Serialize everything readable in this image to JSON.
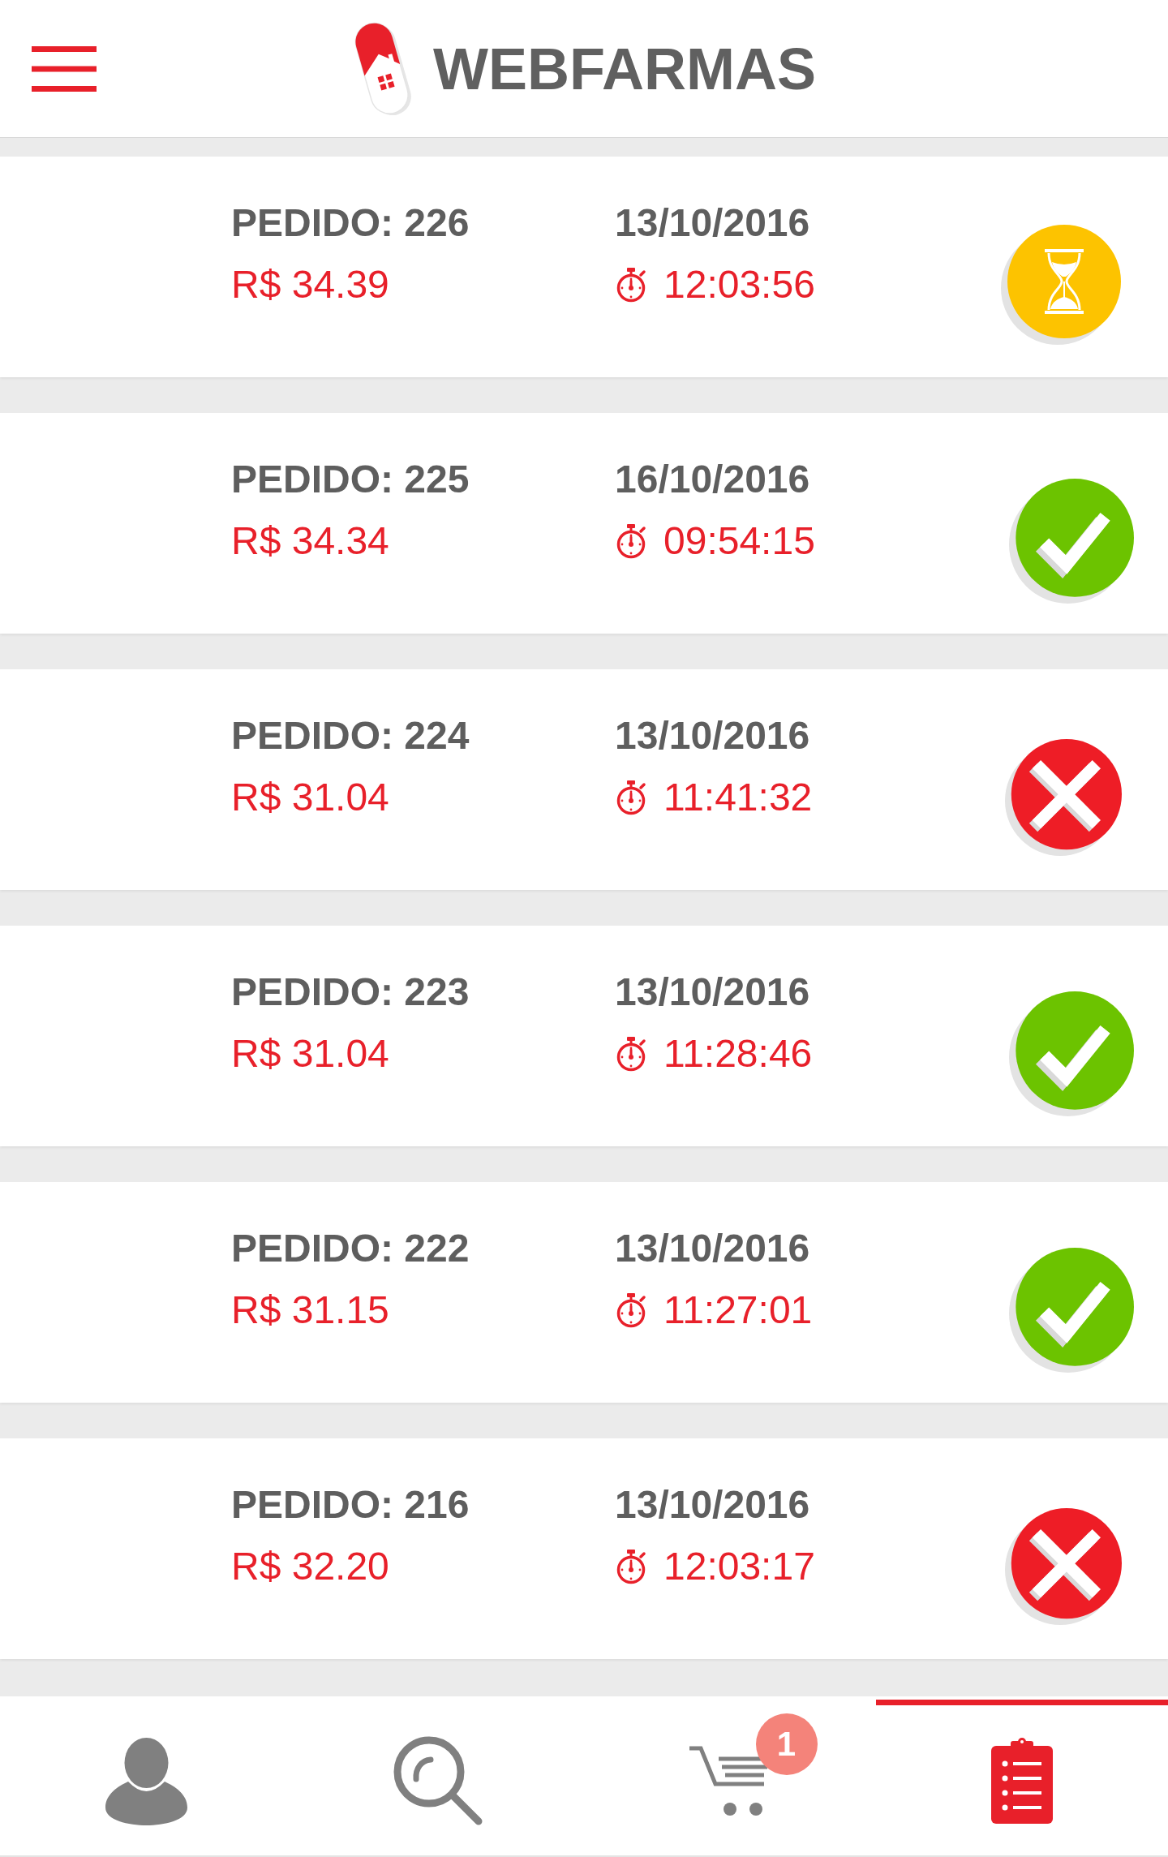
{
  "header": {
    "title": "WEBFARMAS"
  },
  "orders": [
    {
      "number": "PEDIDO: 226",
      "price": "R$ 34.39",
      "date": "13/10/2016",
      "time": "12:03:56",
      "kind": "pending"
    },
    {
      "number": "PEDIDO: 225",
      "price": "R$ 34.34",
      "date": "16/10/2016",
      "time": "09:54:15",
      "kind": "done"
    },
    {
      "number": "PEDIDO: 224",
      "price": "R$ 31.04",
      "date": "13/10/2016",
      "time": "11:41:32",
      "kind": "cancelled"
    },
    {
      "number": "PEDIDO: 223",
      "price": "R$ 31.04",
      "date": "13/10/2016",
      "time": "11:28:46",
      "kind": "done"
    },
    {
      "number": "PEDIDO: 222",
      "price": "R$ 31.15",
      "date": "13/10/2016",
      "time": "11:27:01",
      "kind": "done"
    },
    {
      "number": "PEDIDO: 216",
      "price": "R$ 32.20",
      "date": "13/10/2016",
      "time": "12:03:17",
      "kind": "cancelled"
    }
  ],
  "bottom_nav": {
    "tabs": [
      {
        "kind": "profile",
        "selected": false
      },
      {
        "kind": "search",
        "selected": false
      },
      {
        "kind": "cart",
        "selected": false,
        "badge": "1"
      },
      {
        "kind": "orders",
        "selected": true
      }
    ]
  }
}
